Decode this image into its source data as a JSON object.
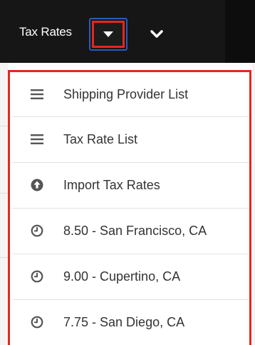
{
  "header": {
    "title": "Tax Rates",
    "caret_icon": "caret-down-icon",
    "chevron_icon": "chevron-down-icon"
  },
  "colors": {
    "header_bg": "#161616",
    "highlight_red": "#e8261c",
    "focus_blue": "#2a5bbf",
    "text": "#333333",
    "icon": "#555555"
  },
  "menu": {
    "items": [
      {
        "icon": "list-icon",
        "label": "Shipping Provider List"
      },
      {
        "icon": "list-icon",
        "label": "Tax Rate List"
      },
      {
        "icon": "upload-circle-icon",
        "label": "Import Tax Rates"
      },
      {
        "icon": "clock-icon",
        "label": "8.50 - San Francisco, CA"
      },
      {
        "icon": "clock-icon",
        "label": "9.00 - Cupertino, CA"
      },
      {
        "icon": "clock-icon",
        "label": "7.75 - San Diego, CA"
      }
    ]
  }
}
